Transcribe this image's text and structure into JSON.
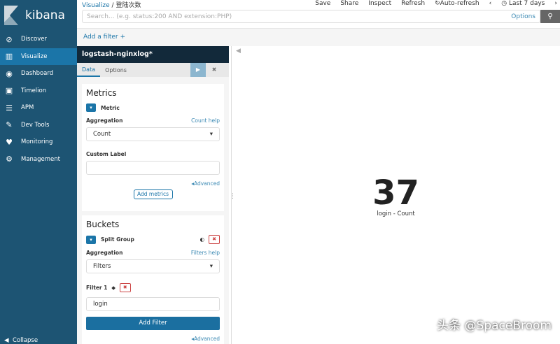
{
  "app": {
    "logo": "kibana"
  },
  "sidebar": {
    "items": [
      {
        "label": "Discover",
        "icon": "compass-icon"
      },
      {
        "label": "Visualize",
        "icon": "bar-chart-icon",
        "active": true
      },
      {
        "label": "Dashboard",
        "icon": "dashboard-icon"
      },
      {
        "label": "Timelion",
        "icon": "shield-icon"
      },
      {
        "label": "APM",
        "icon": "apm-icon"
      },
      {
        "label": "Dev Tools",
        "icon": "wrench-icon"
      },
      {
        "label": "Monitoring",
        "icon": "heartbeat-icon"
      },
      {
        "label": "Management",
        "icon": "gear-icon"
      }
    ],
    "collapse": "Collapse"
  },
  "breadcrumb": {
    "root": "Visualize",
    "sep": "/",
    "current": "登陆次数"
  },
  "menu": {
    "save": "Save",
    "share": "Share",
    "inspect": "Inspect",
    "refresh": "Refresh",
    "auto_refresh": "Auto-refresh",
    "time": "Last 7 days"
  },
  "search": {
    "placeholder": "Search... (e.g. status:200 AND extension:PHP)",
    "options": "Options"
  },
  "filter_bar": {
    "add": "Add a filter +"
  },
  "panel": {
    "index": "logstash-nginxlog*",
    "tabs": [
      "Data",
      "Options"
    ],
    "metrics": {
      "title": "Metrics",
      "agg_title": "Metric",
      "aggregation_label": "Aggregation",
      "help": "Count help",
      "aggregation": "Count",
      "custom_label": "Custom Label",
      "custom_value": "",
      "advanced": "Advanced",
      "add": "Add metrics"
    },
    "buckets": {
      "title": "Buckets",
      "agg_title": "Split Group",
      "aggregation_label": "Aggregation",
      "help": "Filters help",
      "aggregation": "Filters",
      "filter_label": "Filter 1",
      "filter_value": "login",
      "add_filter": "Add Filter",
      "advanced": "Advanced"
    }
  },
  "visualization": {
    "value": "37",
    "label": "login - Count"
  },
  "watermark": "头条 @SpaceBroom"
}
